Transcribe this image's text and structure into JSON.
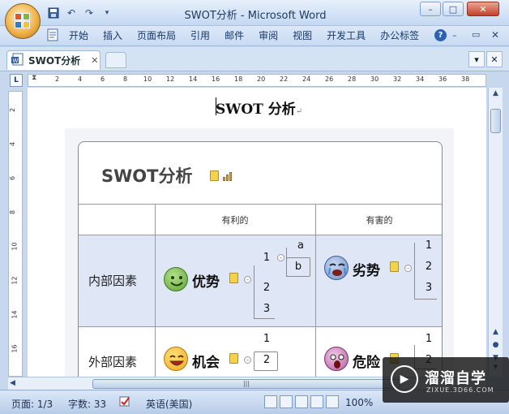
{
  "window": {
    "title": "SWOT分析 - Microsoft Word",
    "buttons": {
      "minimize": "–",
      "maximize": "□",
      "close": "✕"
    }
  },
  "ribbon": {
    "tabs": [
      "开始",
      "插入",
      "页面布局",
      "引用",
      "邮件",
      "审阅",
      "视图",
      "开发工具",
      "办公标签"
    ],
    "help": "?"
  },
  "doc_tabs": {
    "active": "SWOT分析",
    "close": "✕",
    "right_buttons": [
      "▾",
      "✕"
    ]
  },
  "ruler": {
    "corner": "L",
    "h_ticks": [
      "2",
      "4",
      "6",
      "8",
      "10",
      "12",
      "14",
      "16",
      "18",
      "20",
      "22",
      "24",
      "26",
      "28",
      "30",
      "32",
      "34",
      "36",
      "38"
    ],
    "v_ticks": [
      "2",
      "4",
      "6",
      "8",
      "10",
      "12",
      "14",
      "16"
    ]
  },
  "document": {
    "title": "SWOT 分析",
    "mark": "↵",
    "swot": {
      "heading": "SWOT分析",
      "col_headers": [
        "有利的",
        "有害的"
      ],
      "rows": [
        {
          "label": "内部因素"
        },
        {
          "label": "外部因素"
        }
      ],
      "topics": {
        "strength": {
          "label": "优势",
          "subs": [
            "1",
            "2",
            "3"
          ],
          "subsubs": [
            "a",
            "b"
          ]
        },
        "weakness": {
          "label": "劣势",
          "subs": [
            "1",
            "2",
            "3"
          ]
        },
        "opportunity": {
          "label": "机会",
          "subs": [
            "1",
            "2"
          ]
        },
        "threat": {
          "label": "危险",
          "subs": [
            "1",
            "2"
          ]
        }
      }
    }
  },
  "scroll": {
    "h_grip": "|||"
  },
  "statusbar": {
    "page": "页面: 1/3",
    "words": "字数: 33",
    "language": "英语(美国)",
    "zoom": "100%"
  },
  "watermark": {
    "text": "溜溜自学",
    "url": "ZIXUE.3D66.COM"
  }
}
